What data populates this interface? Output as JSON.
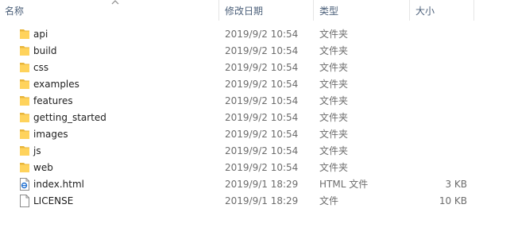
{
  "columns": {
    "name": "名称",
    "modified": "修改日期",
    "type": "类型",
    "size": "大小"
  },
  "files": [
    {
      "name": "api",
      "modified": "2019/9/2 10:54",
      "type": "文件夹",
      "size": "",
      "icon": "folder-icon"
    },
    {
      "name": "build",
      "modified": "2019/9/2 10:54",
      "type": "文件夹",
      "size": "",
      "icon": "folder-icon"
    },
    {
      "name": "css",
      "modified": "2019/9/2 10:54",
      "type": "文件夹",
      "size": "",
      "icon": "folder-icon"
    },
    {
      "name": "examples",
      "modified": "2019/9/2 10:54",
      "type": "文件夹",
      "size": "",
      "icon": "folder-icon"
    },
    {
      "name": "features",
      "modified": "2019/9/2 10:54",
      "type": "文件夹",
      "size": "",
      "icon": "folder-icon"
    },
    {
      "name": "getting_started",
      "modified": "2019/9/2 10:54",
      "type": "文件夹",
      "size": "",
      "icon": "folder-icon"
    },
    {
      "name": "images",
      "modified": "2019/9/2 10:54",
      "type": "文件夹",
      "size": "",
      "icon": "folder-icon"
    },
    {
      "name": "js",
      "modified": "2019/9/2 10:54",
      "type": "文件夹",
      "size": "",
      "icon": "folder-icon"
    },
    {
      "name": "web",
      "modified": "2019/9/2 10:54",
      "type": "文件夹",
      "size": "",
      "icon": "folder-icon"
    },
    {
      "name": "index.html",
      "modified": "2019/9/1 18:29",
      "type": "HTML 文件",
      "size": "3 KB",
      "icon": "html-file-icon"
    },
    {
      "name": "LICENSE",
      "modified": "2019/9/1 18:29",
      "type": "文件",
      "size": "10 KB",
      "icon": "file-icon"
    }
  ],
  "colors": {
    "folder": "#ffd35c",
    "header_text": "#4c607a",
    "separator": "#e5e5e5"
  }
}
